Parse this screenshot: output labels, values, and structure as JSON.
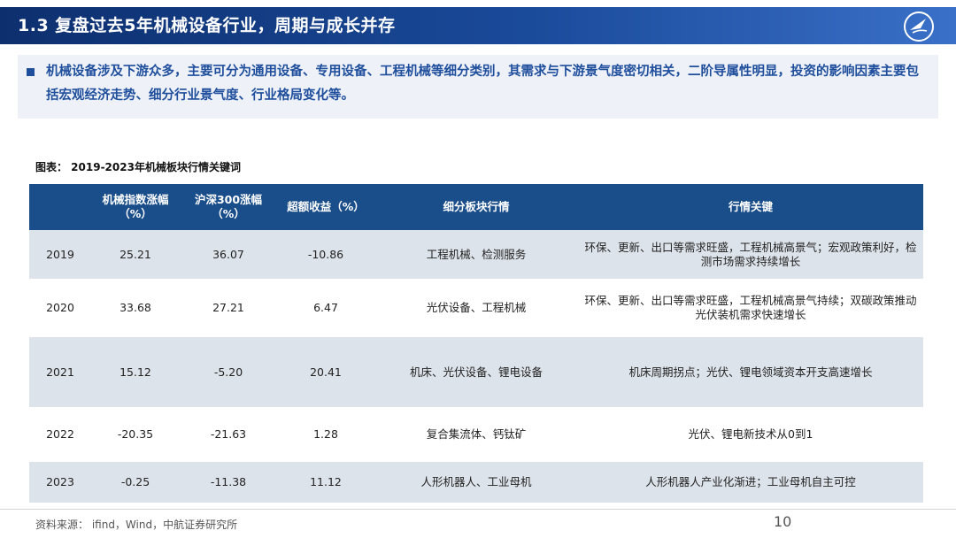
{
  "header": {
    "title": "1.3 复盘过去5年机械设备行业，周期与成长并存"
  },
  "intro": {
    "text": "机械设备涉及下游众多，主要可分为通用设备、专用设备、工程机械等细分类别，其需求与下游景气度密切相关，二阶导属性明显，投资的影响因素主要包括宏观经济走势、细分行业景气度、行业格局变化等。"
  },
  "table": {
    "caption": "图表： 2019-2023年机械板块行情关键词",
    "headers": [
      "",
      "机械指数涨幅（%）",
      "沪深300涨幅（%）",
      "超额收益（%）",
      "细分板块行情",
      "行情关键"
    ],
    "rows": [
      [
        "2019",
        "25.21",
        "36.07",
        "-10.86",
        "工程机械、检测服务",
        "环保、更新、出口等需求旺盛，工程机械高景气；宏观政策利好，检测市场需求持续增长"
      ],
      [
        "2020",
        "33.68",
        "27.21",
        "6.47",
        "光伏设备、工程机械",
        "环保、更新、出口等需求旺盛，工程机械高景气持续；双碳政策推动光伏装机需求快速增长"
      ],
      [
        "2021",
        "15.12",
        "-5.20",
        "20.41",
        "机床、光伏设备、锂电设备",
        "机床周期拐点；光伏、锂电领域资本开支高速增长"
      ],
      [
        "2022",
        "-20.35",
        "-21.63",
        "1.28",
        "复合集流体、钙钛矿",
        "光伏、锂电新技术从0到1"
      ],
      [
        "2023",
        "-0.25",
        "-11.38",
        "11.12",
        "人形机器人、工业母机",
        "人形机器人产业化渐进；工业母机自主可控"
      ]
    ]
  },
  "footer": {
    "source": "资料来源： ifind，Wind，中航证券研究所",
    "page_number": "10"
  },
  "colors": {
    "header_bg": "#1a4a9a",
    "table_header_bg": "#1a4e8a",
    "row_shade": "#dde3ea",
    "intro_text": "#1f4e9c"
  }
}
